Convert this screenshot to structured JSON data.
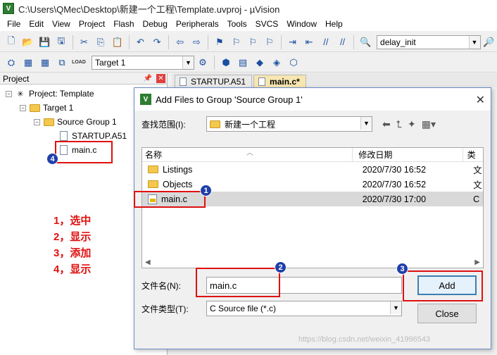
{
  "window": {
    "title": "C:\\Users\\QMec\\Desktop\\新建一个工程\\Template.uvproj - µVision",
    "app_icon_text": "V"
  },
  "menu": [
    "File",
    "Edit",
    "View",
    "Project",
    "Flash",
    "Debug",
    "Peripherals",
    "Tools",
    "SVCS",
    "Window",
    "Help"
  ],
  "toolbar1": {
    "function_combo_value": "delay_init"
  },
  "toolbar2": {
    "target_combo_value": "Target 1",
    "load_label": "LOAD"
  },
  "project_panel": {
    "header": "Project",
    "root": "Project: Template",
    "target": "Target 1",
    "group": "Source Group 1",
    "files": [
      "STARTUP.A51",
      "main.c"
    ]
  },
  "editor_tabs": [
    "STARTUP.A51",
    "main.c*"
  ],
  "annotations": {
    "steps": [
      "1，选中",
      "2，显示",
      "3，添加",
      "4，显示"
    ],
    "badges": [
      "1",
      "2",
      "3",
      "4"
    ]
  },
  "dialog": {
    "title": "Add Files to Group 'Source Group 1'",
    "look_in_label": "查找范围(I):",
    "look_in_value": "新建一个工程",
    "columns": {
      "name": "名称",
      "date": "修改日期",
      "type": "类"
    },
    "files": [
      {
        "name": "Listings",
        "date": "2020/7/30 16:52",
        "type": "文",
        "kind": "folder"
      },
      {
        "name": "Objects",
        "date": "2020/7/30 16:52",
        "type": "文",
        "kind": "folder"
      },
      {
        "name": "main.c",
        "date": "2020/7/30 17:00",
        "type": "C",
        "kind": "cfile"
      }
    ],
    "filename_label": "文件名(N):",
    "filename_value": "main.c",
    "filetype_label": "文件类型(T):",
    "filetype_value": "C Source file (*.c)",
    "add_button": "Add",
    "close_button": "Close"
  },
  "watermark": "https://blog.csdn.net/weixin_41996543"
}
